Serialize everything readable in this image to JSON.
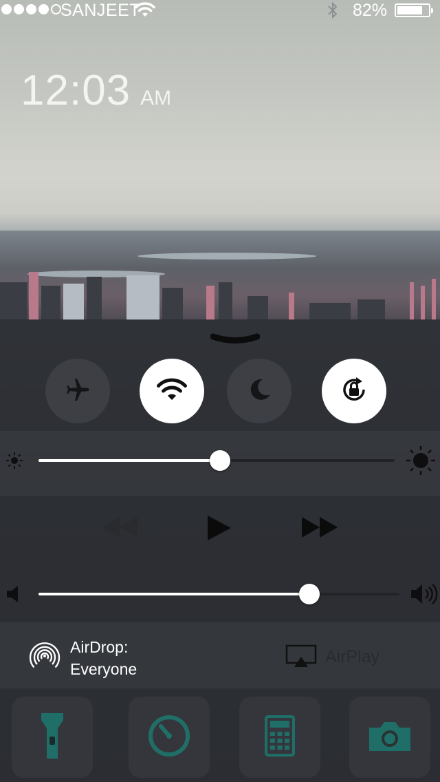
{
  "status_bar": {
    "signal_bars_filled": 4,
    "signal_bars_total": 5,
    "carrier": "SANJEET",
    "battery_percent": "82%",
    "battery_level": 0.82,
    "icons": [
      "wifi-icon",
      "bluetooth-icon",
      "battery-icon"
    ]
  },
  "lock_screen": {
    "time": "12:03",
    "ampm": "AM"
  },
  "control_center": {
    "toggles": [
      {
        "name": "airplane-mode",
        "icon": "airplane-icon",
        "state": "off"
      },
      {
        "name": "wifi",
        "icon": "wifi-icon",
        "state": "on"
      },
      {
        "name": "do-not-disturb",
        "icon": "moon-icon",
        "state": "off"
      },
      {
        "name": "rotation-lock",
        "icon": "rotation-lock-icon",
        "state": "on"
      }
    ],
    "brightness": {
      "level": 0.51
    },
    "media": {
      "controls": [
        "rewind-icon",
        "play-icon",
        "fast-forward-icon"
      ]
    },
    "volume": {
      "level": 0.75
    },
    "airdrop": {
      "label": "AirDrop:",
      "value": "Everyone",
      "icon": "airdrop-icon"
    },
    "airplay": {
      "label": "AirPlay",
      "icon": "airplay-icon"
    },
    "shortcuts": [
      {
        "name": "flashlight",
        "icon": "flashlight-icon"
      },
      {
        "name": "timer",
        "icon": "timer-icon"
      },
      {
        "name": "calculator",
        "icon": "calculator-icon"
      },
      {
        "name": "camera",
        "icon": "camera-icon"
      }
    ],
    "colors": {
      "accent_teal": "#1f6f68",
      "toggle_on": "#ffffff",
      "panel": "#26282d"
    }
  }
}
